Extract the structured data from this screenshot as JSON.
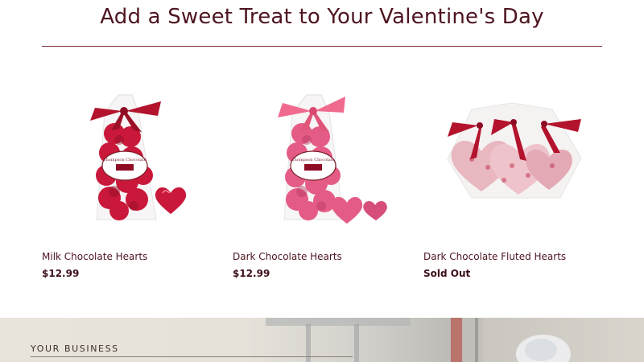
{
  "section": {
    "title": "Add a Sweet Treat to Your Valentine's Day"
  },
  "products": [
    {
      "name": "Milk Chocolate Hearts",
      "price": "$12.99",
      "bag_label_line1": "Thompson Chocolate",
      "ribbon_color": "#b3132c",
      "foil_color": "#c9183a"
    },
    {
      "name": "Dark Chocolate Hearts",
      "price": "$12.99",
      "bag_label_line1": "Thompson Chocolate",
      "ribbon_color": "#f06a8e",
      "foil_color": "#e45c86"
    },
    {
      "name": "Dark Chocolate Fluted Hearts",
      "price": "Sold Out",
      "ribbon_color": "#b3132c",
      "foil_color": "#e8b7c0"
    }
  ],
  "business": {
    "eyebrow": "YOUR BUSINESS"
  },
  "colors": {
    "heading": "#4e1520",
    "rule": "#7a2a36",
    "price": "#3d0f18"
  }
}
